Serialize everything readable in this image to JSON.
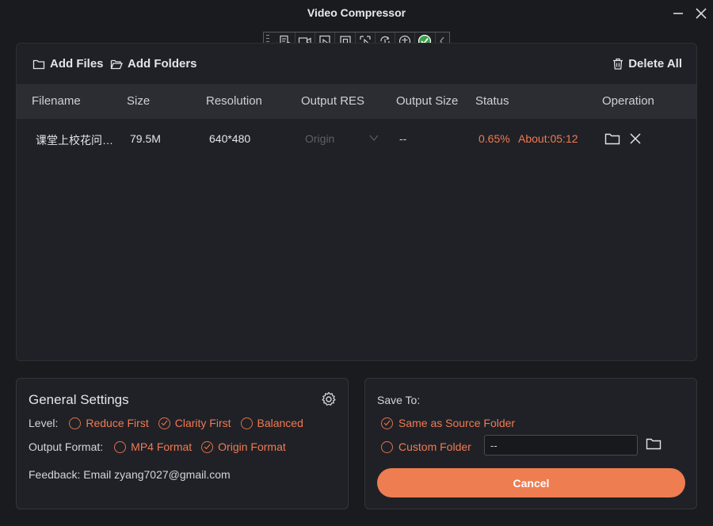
{
  "window": {
    "title": "Video Compressor"
  },
  "actions": {
    "add_files": "Add Files",
    "add_folders": "Add Folders",
    "delete_all": "Delete All"
  },
  "table": {
    "columns": [
      "Filename",
      "Size",
      "Resolution",
      "Output RES",
      "Output Size",
      "Status",
      "Operation"
    ],
    "rows": [
      {
        "filename": "课堂上校花问…",
        "size": "79.5M",
        "resolution": "640*480",
        "output_res": "Origin",
        "output_size": "--",
        "progress": "0.65%",
        "eta": "About:05:12"
      }
    ]
  },
  "settings": {
    "title": "General Settings",
    "level_label": "Level:",
    "level_options": [
      "Reduce First",
      "Clarity First",
      "Balanced"
    ],
    "level_selected": "Clarity First",
    "format_label": "Output Format:",
    "format_options": [
      "MP4 Format",
      "Origin Format"
    ],
    "format_selected": "Origin Format",
    "feedback": "Feedback: Email zyang7027@gmail.com"
  },
  "save_to": {
    "title": "Save To:",
    "same_source": "Same as Source Folder",
    "custom_folder": "Custom Folder",
    "selected": "Same as Source Folder",
    "folder_value": "--"
  },
  "cancel_label": "Cancel",
  "colors": {
    "accent": "#ee7d51",
    "background": "#1a1b1f",
    "panel": "#202126",
    "header": "#2c2d32"
  }
}
